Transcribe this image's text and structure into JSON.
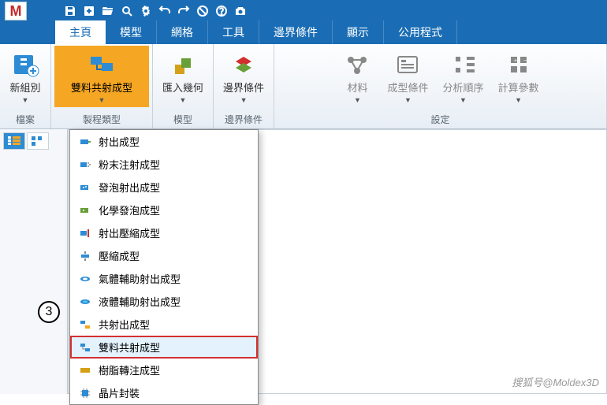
{
  "qat": {
    "logo": "M"
  },
  "tabs": {
    "items": [
      {
        "label": "主頁"
      },
      {
        "label": "模型"
      },
      {
        "label": "網格"
      },
      {
        "label": "工具"
      },
      {
        "label": "邊界條件"
      },
      {
        "label": "顯示"
      },
      {
        "label": "公用程式"
      }
    ]
  },
  "ribbon": {
    "groups": [
      {
        "label": "檔案",
        "buttons": [
          {
            "label": "新組別"
          }
        ]
      },
      {
        "label": "製程類型",
        "buttons": [
          {
            "label": "雙料共射成型"
          }
        ]
      },
      {
        "label": "模型",
        "buttons": [
          {
            "label": "匯入幾何"
          }
        ]
      },
      {
        "label": "邊界條件",
        "buttons": [
          {
            "label": "邊界條件"
          }
        ]
      },
      {
        "label": "設定",
        "buttons": [
          {
            "label": "材料"
          },
          {
            "label": "成型條件"
          },
          {
            "label": "分析順序"
          },
          {
            "label": "計算參數"
          }
        ]
      }
    ]
  },
  "menu": {
    "items": [
      {
        "label": "射出成型"
      },
      {
        "label": "粉末注射成型"
      },
      {
        "label": "發泡射出成型"
      },
      {
        "label": "化學發泡成型"
      },
      {
        "label": "射出壓縮成型"
      },
      {
        "label": "壓縮成型"
      },
      {
        "label": "氣體輔助射出成型"
      },
      {
        "label": "液體輔助射出成型"
      },
      {
        "label": "共射出成型"
      },
      {
        "label": "雙料共射成型"
      },
      {
        "label": "樹脂轉注成型"
      },
      {
        "label": "晶片封裝"
      }
    ]
  },
  "callout": "3",
  "watermark": "搜狐号@Moldex3D"
}
